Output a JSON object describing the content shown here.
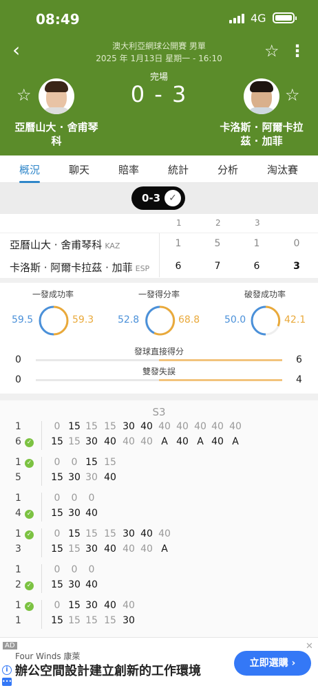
{
  "status_bar": {
    "time": "08:49",
    "network": "4G"
  },
  "header": {
    "tournament": "澳大利亞網球公開賽 男單",
    "datetime": "2025 年 1月13日 星期一 - 16:10",
    "status": "完場",
    "score": "0 - 3",
    "player_left": "亞曆山大 · 舍甫琴科",
    "player_right": "卡洛斯 · 阿爾卡拉茲 · 加菲"
  },
  "tabs": [
    "概況",
    "聊天",
    "賠率",
    "統計",
    "分析",
    "淘汰賽"
  ],
  "active_tab": "概況",
  "set_pill": {
    "score": "0-3"
  },
  "scoreboard": {
    "set_headers": [
      "1",
      "2",
      "3"
    ],
    "rows": [
      {
        "name": "亞曆山大 · 舍甫琴科",
        "country": "KAZ",
        "sets": [
          "1",
          "5",
          "1"
        ],
        "total": "0"
      },
      {
        "name": "卡洛斯 · 阿爾卡拉茲 · 加菲",
        "country": "ESP",
        "sets": [
          "6",
          "7",
          "6"
        ],
        "total": "3"
      }
    ]
  },
  "stats": {
    "rings": [
      {
        "label": "一發成功率",
        "left": "59.5",
        "right": "59.3"
      },
      {
        "label": "一發得分率",
        "left": "52.8",
        "right": "68.8"
      },
      {
        "label": "破發成功率",
        "left": "50.0",
        "right": "42.1"
      }
    ],
    "bars": [
      {
        "label": "發球直接得分",
        "left": "0",
        "right": "6"
      },
      {
        "label": "雙發失誤",
        "left": "0",
        "right": "4"
      }
    ]
  },
  "points": {
    "set_label": "S3",
    "games": [
      {
        "top": "1",
        "bottom": "6",
        "ball": "bottom",
        "top_pts": [
          "0",
          "15",
          "15",
          "15",
          "30",
          "40",
          "40",
          "40",
          "40",
          "40",
          "40"
        ],
        "bottom_pts": [
          "15",
          "15",
          "30",
          "40",
          "40",
          "40",
          "A",
          "40",
          "A",
          "40",
          "A"
        ]
      },
      {
        "top": "1",
        "bottom": "5",
        "ball": "top",
        "top_pts": [
          "0",
          "0",
          "15",
          "15"
        ],
        "bottom_pts": [
          "15",
          "30",
          "30",
          "40"
        ]
      },
      {
        "top": "1",
        "bottom": "4",
        "ball": "bottom",
        "top_pts": [
          "0",
          "0",
          "0"
        ],
        "bottom_pts": [
          "15",
          "30",
          "40"
        ]
      },
      {
        "top": "1",
        "bottom": "3",
        "ball": "top",
        "top_pts": [
          "0",
          "15",
          "15",
          "15",
          "30",
          "40",
          "40"
        ],
        "bottom_pts": [
          "15",
          "15",
          "30",
          "40",
          "40",
          "40",
          "A"
        ]
      },
      {
        "top": "1",
        "bottom": "2",
        "ball": "bottom",
        "top_pts": [
          "0",
          "0",
          "0"
        ],
        "bottom_pts": [
          "15",
          "30",
          "40"
        ]
      },
      {
        "top": "1",
        "bottom": "1",
        "ball": "top",
        "top_pts": [
          "0",
          "15",
          "30",
          "40",
          "40"
        ],
        "bottom_pts": [
          "15",
          "15",
          "15",
          "15",
          "30"
        ]
      }
    ]
  },
  "ad": {
    "tag": "AD",
    "brand": "Four Winds 康萊",
    "title": "辦公空間設計建立創新的工作環境",
    "cta": "立即選購 ›",
    "close": "✕"
  },
  "colors": {
    "header_green": "#5b8c2a",
    "accent_blue": "#2f86c9",
    "left_player": "#4a90d9",
    "right_player": "#e9a93a"
  }
}
